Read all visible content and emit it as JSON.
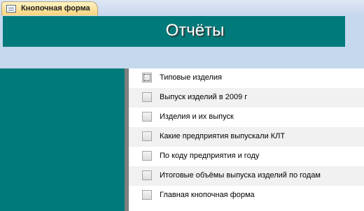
{
  "tab": {
    "label": "Кнопочная форма",
    "icon": "form-icon"
  },
  "header": {
    "title": "Отчёты"
  },
  "colors": {
    "header_bg": "#007a7a",
    "form_bg": "#c5d8ee",
    "tab_bg": "#f7d37d"
  },
  "items": [
    {
      "label": "Типовые изделия"
    },
    {
      "label": "Выпуск изделий в 2009 г"
    },
    {
      "label": "Изделия и их выпуск"
    },
    {
      "label": "Какие предприятия выпускали КЛТ"
    },
    {
      "label": "По коду предприятия и году"
    },
    {
      "label": "Итоговые объёмы выпуска изделий по годам"
    },
    {
      "label": "Главная кнопочная форма"
    }
  ]
}
